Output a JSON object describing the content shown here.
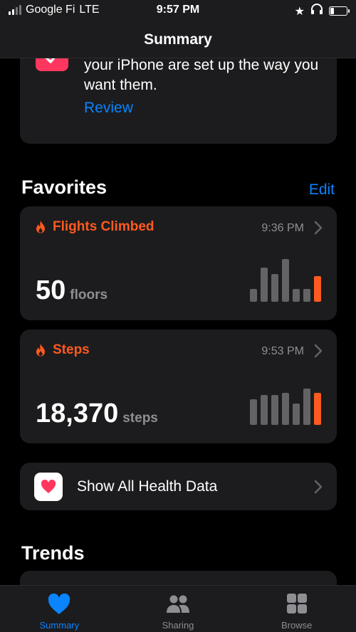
{
  "status_bar": {
    "carrier": "Google Fi",
    "network": "LTE",
    "time": "9:57 PM"
  },
  "nav": {
    "title": "Summary"
  },
  "review_card": {
    "text": "make sure the Health features on your iPhone are set up the way you want them.",
    "link": "Review"
  },
  "favorites": {
    "title": "Favorites",
    "edit_label": "Edit",
    "items": [
      {
        "name": "Flights Climbed",
        "time": "9:36 PM",
        "value": "50",
        "unit": "floors",
        "bars": [
          0.3,
          0.8,
          0.65,
          1.0,
          0.3,
          0.3,
          0.8
        ]
      },
      {
        "name": "Steps",
        "time": "9:53 PM",
        "value": "18,370",
        "unit": "steps",
        "bars": [
          0.6,
          0.7,
          0.7,
          0.75,
          0.5,
          0.85,
          1.0
        ]
      }
    ]
  },
  "show_all": {
    "label": "Show All Health Data"
  },
  "trends": {
    "title": "Trends"
  },
  "tabs": [
    {
      "label": "Summary",
      "icon": "heart-icon",
      "active": true
    },
    {
      "label": "Sharing",
      "icon": "people-icon",
      "active": false
    },
    {
      "label": "Browse",
      "icon": "grid-icon",
      "active": false
    }
  ],
  "colors": {
    "accent": "#0a84ff",
    "metric": "#ff5a1f",
    "health_pink": "#ff375f"
  }
}
